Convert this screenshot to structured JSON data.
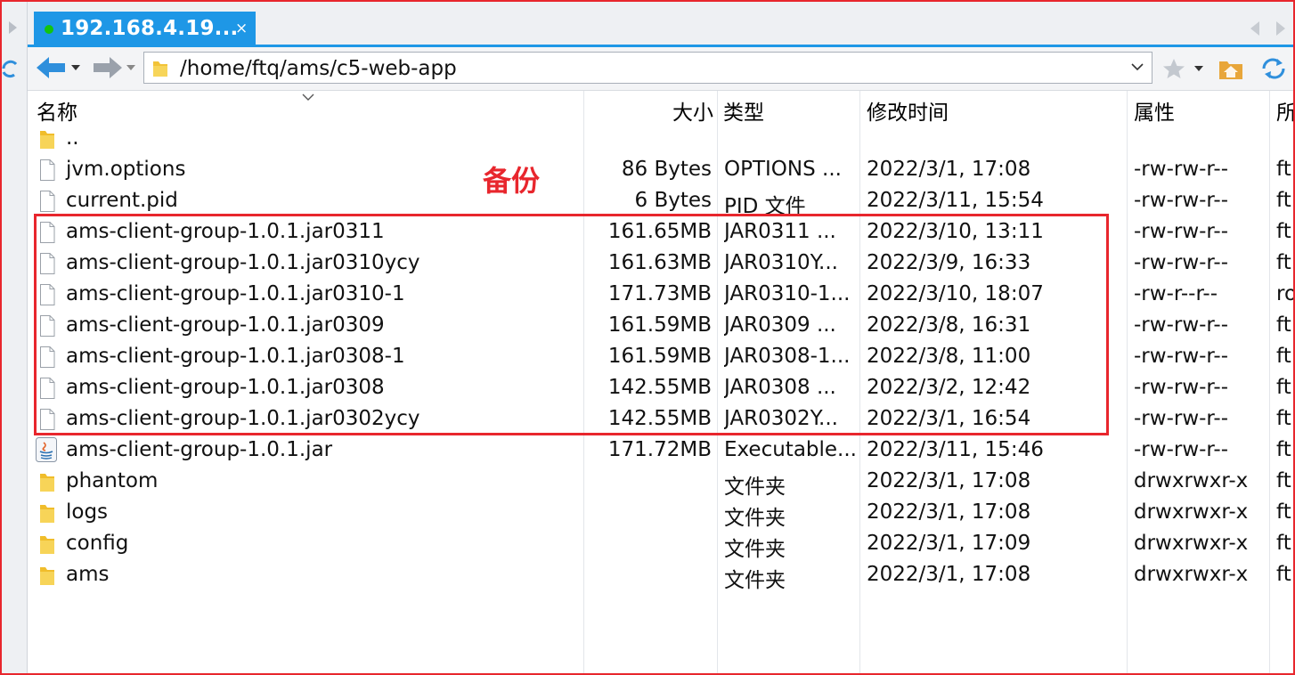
{
  "tab": {
    "title": "192.168.4.19...",
    "close": "×",
    "status_color": "#13c40f",
    "accent": "#1e97e6"
  },
  "toolbar": {
    "path": "/home/ftq/ams/c5-web-app"
  },
  "columns": {
    "name": "名称",
    "size": "大小",
    "type": "类型",
    "modified": "修改时间",
    "attrs": "属性",
    "owner": "所"
  },
  "annotation": {
    "label": "备份",
    "color": "#e8262d"
  },
  "files": [
    {
      "icon": "folder-icon",
      "name": "..",
      "size": "",
      "type": "",
      "modified": "",
      "attrs": "",
      "owner": ""
    },
    {
      "icon": "file-icon",
      "name": "jvm.options",
      "size": "86 Bytes",
      "type": "OPTIONS ...",
      "modified": "2022/3/1, 17:08",
      "attrs": "-rw-rw-r--",
      "owner": "ft"
    },
    {
      "icon": "file-icon",
      "name": "current.pid",
      "size": "6 Bytes",
      "type": "PID 文件",
      "modified": "2022/3/11, 15:54",
      "attrs": "-rw-rw-r--",
      "owner": "ft"
    },
    {
      "icon": "file-icon",
      "name": "ams-client-group-1.0.1.jar0311",
      "size": "161.65MB",
      "type": "JAR0311 ...",
      "modified": "2022/3/10, 13:11",
      "attrs": "-rw-rw-r--",
      "owner": "ft"
    },
    {
      "icon": "file-icon",
      "name": "ams-client-group-1.0.1.jar0310ycy",
      "size": "161.63MB",
      "type": "JAR0310Y...",
      "modified": "2022/3/9, 16:33",
      "attrs": "-rw-rw-r--",
      "owner": "ft"
    },
    {
      "icon": "file-icon",
      "name": "ams-client-group-1.0.1.jar0310-1",
      "size": "171.73MB",
      "type": "JAR0310-1...",
      "modified": "2022/3/10, 18:07",
      "attrs": "-rw-r--r--",
      "owner": "ro"
    },
    {
      "icon": "file-icon",
      "name": "ams-client-group-1.0.1.jar0309",
      "size": "161.59MB",
      "type": "JAR0309 ...",
      "modified": "2022/3/8, 16:31",
      "attrs": "-rw-rw-r--",
      "owner": "ft"
    },
    {
      "icon": "file-icon",
      "name": "ams-client-group-1.0.1.jar0308-1",
      "size": "161.59MB",
      "type": "JAR0308-1...",
      "modified": "2022/3/8, 11:00",
      "attrs": "-rw-rw-r--",
      "owner": "ft"
    },
    {
      "icon": "file-icon",
      "name": "ams-client-group-1.0.1.jar0308",
      "size": "142.55MB",
      "type": "JAR0308 ...",
      "modified": "2022/3/2, 12:42",
      "attrs": "-rw-rw-r--",
      "owner": "ft"
    },
    {
      "icon": "file-icon",
      "name": "ams-client-group-1.0.1.jar0302ycy",
      "size": "142.55MB",
      "type": "JAR0302Y...",
      "modified": "2022/3/1, 16:54",
      "attrs": "-rw-rw-r--",
      "owner": "ft"
    },
    {
      "icon": "java-icon",
      "name": "ams-client-group-1.0.1.jar",
      "size": "171.72MB",
      "type": "Executable...",
      "modified": "2022/3/11, 15:46",
      "attrs": "-rw-rw-r--",
      "owner": "ft"
    },
    {
      "icon": "folder-icon",
      "name": "phantom",
      "size": "",
      "type": "文件夹",
      "modified": "2022/3/1, 17:08",
      "attrs": "drwxrwxr-x",
      "owner": "ft"
    },
    {
      "icon": "folder-icon",
      "name": "logs",
      "size": "",
      "type": "文件夹",
      "modified": "2022/3/1, 17:08",
      "attrs": "drwxrwxr-x",
      "owner": "ft"
    },
    {
      "icon": "folder-icon",
      "name": "config",
      "size": "",
      "type": "文件夹",
      "modified": "2022/3/1, 17:09",
      "attrs": "drwxrwxr-x",
      "owner": "ft"
    },
    {
      "icon": "folder-icon",
      "name": "ams",
      "size": "",
      "type": "文件夹",
      "modified": "2022/3/1, 17:08",
      "attrs": "drwxrwxr-x",
      "owner": "ft"
    }
  ]
}
